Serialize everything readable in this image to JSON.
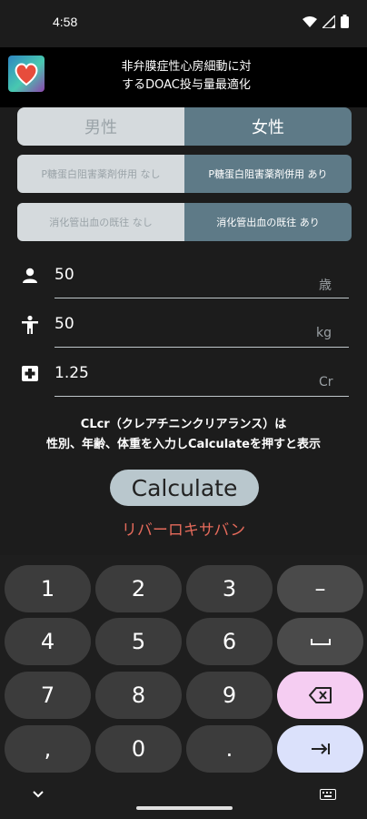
{
  "status_bar": {
    "time": "4:58"
  },
  "app": {
    "title_line1": "非弁膜症性心房細動に対",
    "title_line2": "するDOAC投与量最適化"
  },
  "gender": {
    "male": "男性",
    "female": "女性",
    "selected": "female"
  },
  "pgp": {
    "no": "P糖蛋白阻害薬剤併用 なし",
    "yes": "P糖蛋白阻害薬剤併用 あり",
    "selected": "yes"
  },
  "gi_bleeding": {
    "no": "消化管出血の既往 なし",
    "yes": "消化管出血の既往  あり",
    "selected": "yes"
  },
  "inputs": {
    "age": {
      "value": "50",
      "unit": "歳",
      "icon": "person-icon"
    },
    "weight": {
      "value": "50",
      "unit": "kg",
      "icon": "standing-person-icon"
    },
    "creatinine": {
      "value": "1.25",
      "unit": "Cr",
      "icon": "medical-cross-icon"
    }
  },
  "explain": {
    "line1": "CLcr（クレアチニンクリアランス）は",
    "line2": "性別、年齢、体重を入力しCalculateを押すと表示"
  },
  "calculate_label": "Calculate",
  "drug_name": "リバーロキサバン",
  "keyboard": {
    "keys": [
      "1",
      "2",
      "3",
      "–",
      "4",
      "5",
      "6",
      "␣",
      "7",
      "8",
      "9",
      "⌫",
      "，",
      "0",
      ".",
      "⇥"
    ],
    "row1": [
      "1",
      "2",
      "3",
      "–"
    ],
    "row2": [
      "4",
      "5",
      "6"
    ],
    "row3": [
      "7",
      "8",
      "9"
    ],
    "row4": [
      ",",
      "0",
      "."
    ]
  },
  "colors": {
    "selected_segment": "#5e7a87",
    "unselected_segment": "#d5dadd",
    "drug_name": "#e56a5b",
    "delete_key": "#f5cdf2",
    "tab_key": "#dbe1fb"
  }
}
